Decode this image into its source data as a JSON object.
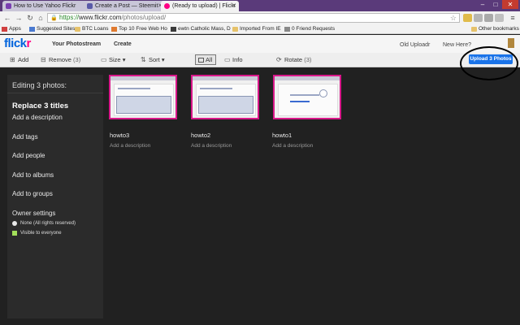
{
  "browser": {
    "tabs": [
      {
        "title": "How to Use Yahoo Flickr",
        "active": false
      },
      {
        "title": "Create a Post — Steemit",
        "active": false
      },
      {
        "title": "(Ready to upload) | Flickr",
        "active": true
      }
    ],
    "url_scheme": "https://",
    "url_host": "www.flickr.com",
    "url_path": "/photos/upload/",
    "bookmarks": [
      {
        "label": "Apps",
        "icon": "apps-grid-icon"
      },
      {
        "label": "Suggested Sites",
        "icon": "suggested-sites-icon"
      },
      {
        "label": "BTC Loans",
        "icon": "folder-icon"
      },
      {
        "label": "Top 10 Free Web Ho",
        "icon": "bookmark-icon"
      },
      {
        "label": "ewtn Catholic Mass, D",
        "icon": "bookmark-icon"
      },
      {
        "label": "Imported From IE",
        "icon": "folder-icon"
      },
      {
        "label": "0 Friend Requests",
        "icon": "bookmark-icon"
      },
      {
        "label": "Other bookmarks",
        "icon": "folder-icon"
      }
    ]
  },
  "header": {
    "logo_part1": "flick",
    "logo_part2": "r",
    "nav": [
      "Your Photostream",
      "Create"
    ],
    "right": [
      "Old Uploadr",
      "New Here?"
    ]
  },
  "toolbar": {
    "add_label": "Add",
    "remove_label": "Remove",
    "remove_count": "(3)",
    "size_label": "Size",
    "sort_label": "Sort",
    "all_label": "All",
    "info_label": "Info",
    "rotate_label": "Rotate",
    "rotate_count": "(3)",
    "upload_label": "Upload 3 Photos"
  },
  "left_panel": {
    "editing": "Editing 3 photos:",
    "replace_titles": "Replace 3 titles",
    "add_description": "Add a description",
    "add_tags": "Add tags",
    "add_people": "Add people",
    "add_albums": "Add to albums",
    "add_groups": "Add to groups",
    "owner_settings": "Owner settings",
    "license": "None (All rights reserved)",
    "visibility": "Visible to everyone"
  },
  "photos": [
    {
      "title": "howto3",
      "desc": "Add a description"
    },
    {
      "title": "howto2",
      "desc": "Add a description"
    },
    {
      "title": "howto1",
      "desc": "Add a description"
    }
  ],
  "colors": {
    "flickr_blue": "#0063dc",
    "flickr_pink": "#ff0084",
    "upload_button": "#1a73e8",
    "selected_border": "#d9188a"
  }
}
